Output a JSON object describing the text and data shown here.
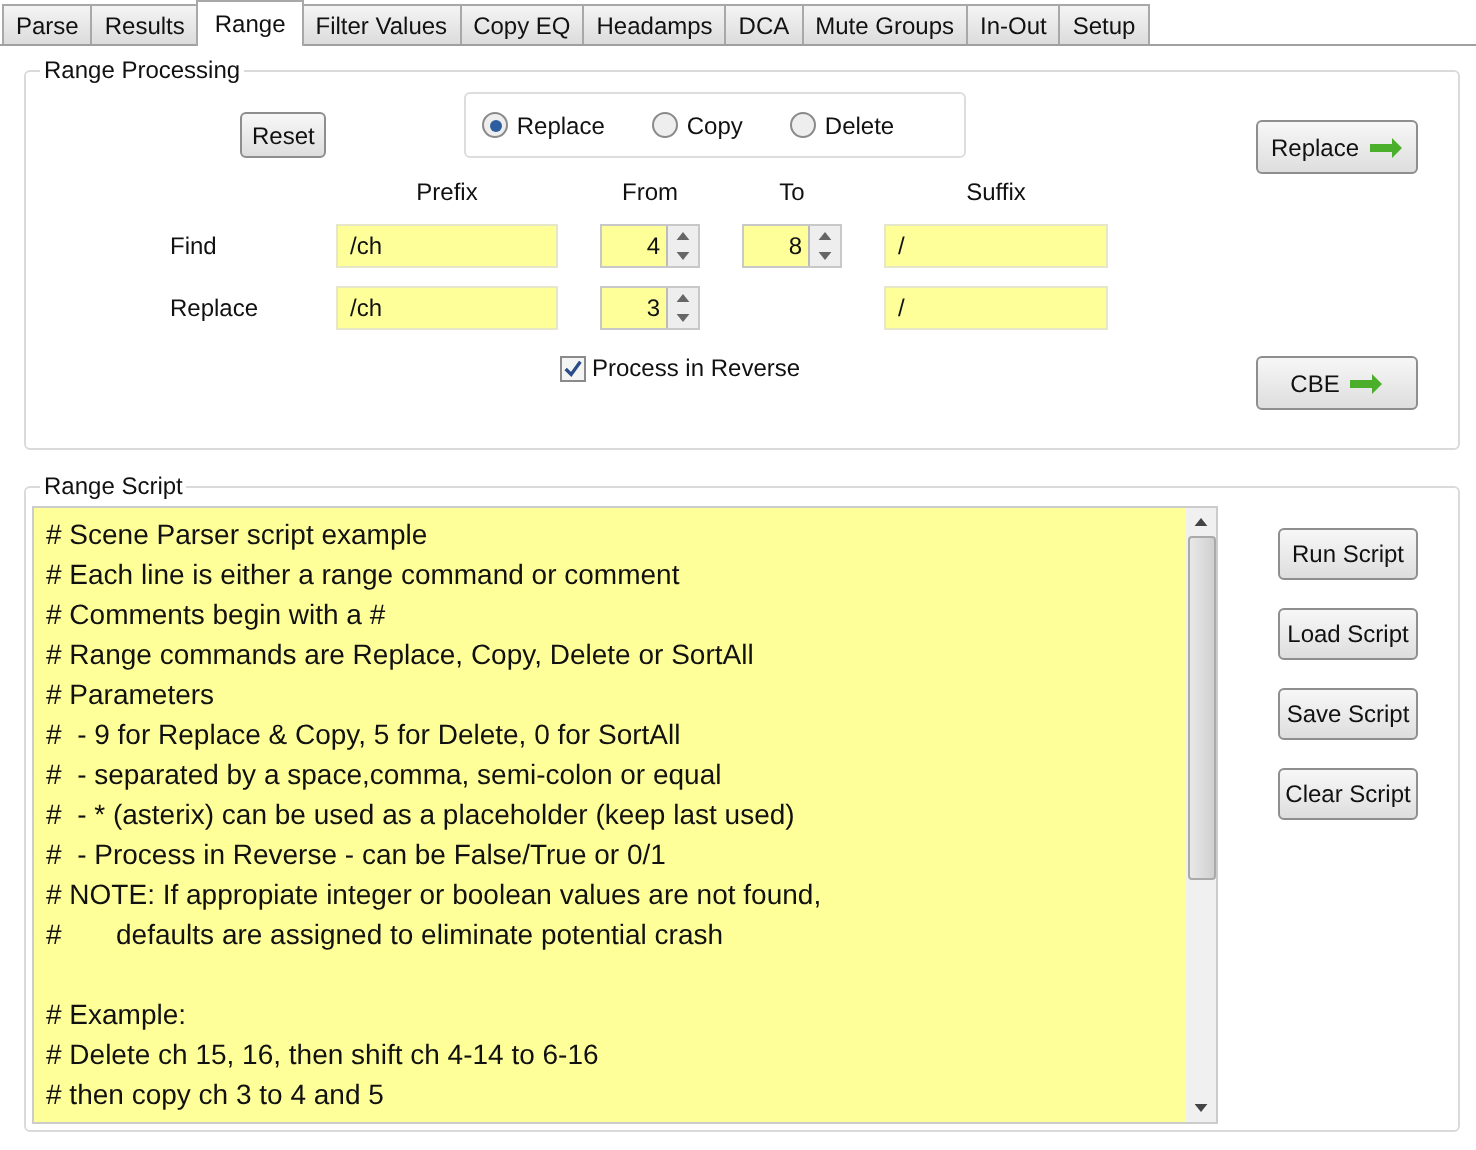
{
  "tabs": [
    {
      "label": "Parse",
      "selected": false
    },
    {
      "label": "Results",
      "selected": false
    },
    {
      "label": "Range",
      "selected": true
    },
    {
      "label": "Filter Values",
      "selected": false
    },
    {
      "label": "Copy EQ",
      "selected": false
    },
    {
      "label": "Headamps",
      "selected": false
    },
    {
      "label": "DCA",
      "selected": false
    },
    {
      "label": "Mute Groups",
      "selected": false
    },
    {
      "label": "In-Out",
      "selected": false
    },
    {
      "label": "Setup",
      "selected": false
    }
  ],
  "range_processing": {
    "title": "Range Processing",
    "reset_button": "Reset",
    "modes": [
      {
        "label": "Replace",
        "selected": true
      },
      {
        "label": "Copy",
        "selected": false
      },
      {
        "label": "Delete",
        "selected": false
      }
    ],
    "action_button": "Replace",
    "columns": [
      "Prefix",
      "From",
      "To",
      "Suffix"
    ],
    "rows": [
      {
        "label": "Find",
        "prefix": "/ch",
        "from": "4",
        "to": "8",
        "suffix": "/"
      },
      {
        "label": "Replace",
        "prefix": "/ch",
        "from": "3",
        "suffix": "/"
      }
    ],
    "process_in_reverse": {
      "label": "Process in Reverse",
      "checked": true
    },
    "cbe_button": "CBE"
  },
  "range_script": {
    "title": "Range Script",
    "text": "# Scene Parser script example\n# Each line is either a range command or comment\n# Comments begin with a #\n# Range commands are Replace, Copy, Delete or SortAll\n# Parameters\n#  - 9 for Replace & Copy, 5 for Delete, 0 for SortAll\n#  - separated by a space,comma, semi-colon or equal\n#  - * (asterix) can be used as a placeholder (keep last used)\n#  - Process in Reverse - can be False/True or 0/1\n# NOTE: If appropiate integer or boolean values are not found,\n#       defaults are assigned to eliminate potential crash\n\n# Example:\n# Delete ch 15, 16, then shift ch 4-14 to 6-16\n# then copy ch 3 to 4 and 5",
    "buttons": [
      "Run Script",
      "Load Script",
      "Save Script",
      "Clear Script"
    ]
  }
}
